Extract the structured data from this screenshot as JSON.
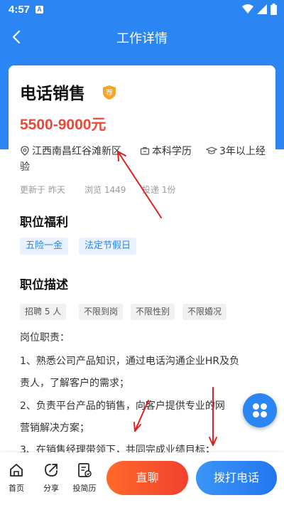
{
  "status_bar": {
    "time": "4:57",
    "notification_letter": "A"
  },
  "nav": {
    "title": "工作详情"
  },
  "job": {
    "title": "电话销售",
    "badge": "荐",
    "salary": "5500-9000元",
    "location_line1": "江西南昌红谷滩新区",
    "education": "本科学历",
    "experience_line1": "3年以上经",
    "experience_line2": "验",
    "updated": "更新于 昨天",
    "views": "浏览 1449",
    "applications": "投递 1份"
  },
  "welfare": {
    "heading": "职位福利",
    "tags": [
      "五险一金",
      "法定节假日"
    ]
  },
  "description": {
    "heading": "职位描述",
    "tags": [
      "招聘 5 人",
      "不限到岗",
      "不限性别",
      "不限婚况"
    ],
    "lines": [
      "岗位职责：",
      "1、熟悉公司产品知识，通过电话沟通企业HR及负",
      "责人，了解客户的需求；",
      "2、负责平台产品的销售，向客户提供专业的网",
      "营销解决方案；",
      "3、在销售经理带领下，共同完成业绩目标；"
    ]
  },
  "bottom_bar": {
    "tabs": [
      {
        "label": "首页",
        "icon": "home-icon"
      },
      {
        "label": "分享",
        "icon": "share-icon"
      },
      {
        "label": "投简历",
        "icon": "resume-icon"
      }
    ],
    "chat_label": "直聊",
    "call_label": "拨打电话"
  },
  "colors": {
    "primary": "#2b86f4",
    "salary": "#e8493b",
    "badge": "#f5a623",
    "annotation_arrow": "#e02020",
    "chat_button": "#f2412f",
    "call_button": "#2276ee"
  }
}
